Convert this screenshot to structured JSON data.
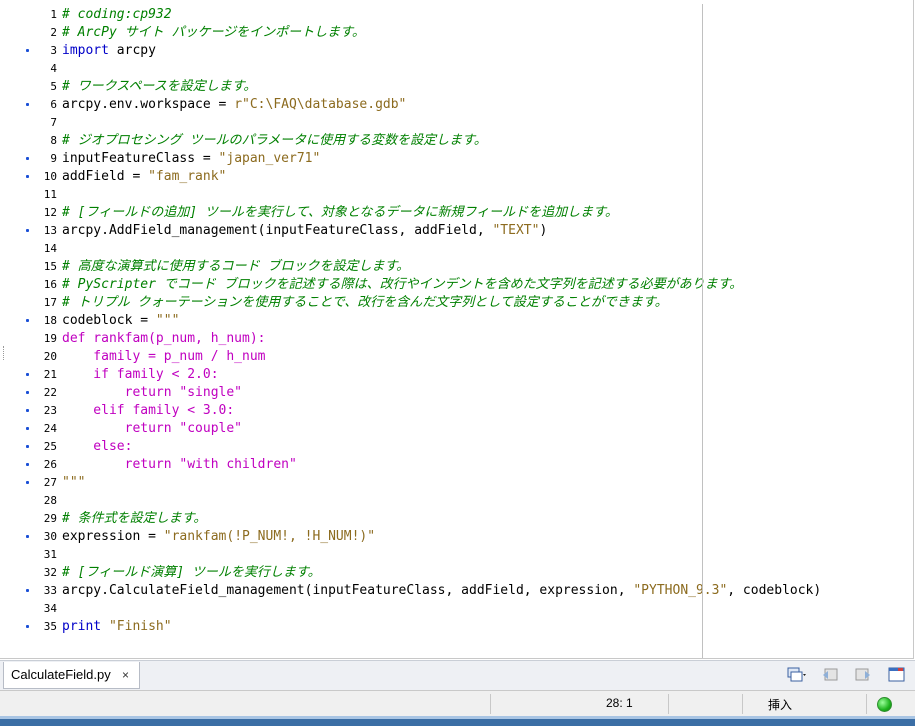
{
  "editor": {
    "lines": [
      {
        "n": "1",
        "bp": false,
        "tokens": [
          {
            "t": "# coding:cp932",
            "c": "comment"
          }
        ]
      },
      {
        "n": "2",
        "bp": false,
        "tokens": [
          {
            "t": "# ArcPy サイト パッケージをインポートします。",
            "c": "comment"
          }
        ]
      },
      {
        "n": "3",
        "bp": true,
        "tokens": [
          {
            "t": "import",
            "c": "keyword"
          },
          {
            "t": " arcpy",
            "c": "plain"
          }
        ]
      },
      {
        "n": "4",
        "bp": false,
        "tokens": []
      },
      {
        "n": "5",
        "bp": false,
        "tokens": [
          {
            "t": "# ワークスペースを設定します。",
            "c": "comment"
          }
        ]
      },
      {
        "n": "6",
        "bp": true,
        "tokens": [
          {
            "t": "arcpy.env.workspace = ",
            "c": "plain"
          },
          {
            "t": "r\"C:\\FAQ\\database.gdb\"",
            "c": "string"
          }
        ]
      },
      {
        "n": "7",
        "bp": false,
        "tokens": []
      },
      {
        "n": "8",
        "bp": false,
        "tokens": [
          {
            "t": "# ジオプロセシング ツールのパラメータに使用する変数を設定します。",
            "c": "comment"
          }
        ]
      },
      {
        "n": "9",
        "bp": true,
        "tokens": [
          {
            "t": "inputFeatureClass = ",
            "c": "plain"
          },
          {
            "t": "\"japan_ver71\"",
            "c": "string"
          }
        ]
      },
      {
        "n": "10",
        "bp": true,
        "tokens": [
          {
            "t": "addField = ",
            "c": "plain"
          },
          {
            "t": "\"fam_rank\"",
            "c": "string"
          }
        ]
      },
      {
        "n": "11",
        "bp": false,
        "tokens": []
      },
      {
        "n": "12",
        "bp": false,
        "tokens": [
          {
            "t": "# [フィールドの追加] ツールを実行して、対象となるデータに新規フィールドを追加します。",
            "c": "comment"
          }
        ]
      },
      {
        "n": "13",
        "bp": true,
        "tokens": [
          {
            "t": "arcpy.AddField_management(inputFeatureClass, addField, ",
            "c": "plain"
          },
          {
            "t": "\"TEXT\"",
            "c": "string"
          },
          {
            "t": ")",
            "c": "plain"
          }
        ]
      },
      {
        "n": "14",
        "bp": false,
        "tokens": []
      },
      {
        "n": "15",
        "bp": false,
        "tokens": [
          {
            "t": "# 高度な演算式に使用するコード ブロックを設定します。",
            "c": "comment"
          }
        ]
      },
      {
        "n": "16",
        "bp": false,
        "tokens": [
          {
            "t": "# PyScripter でコード ブロックを記述する際は、改行やインデントを含めた文字列を記述する必要があります。",
            "c": "comment"
          }
        ]
      },
      {
        "n": "17",
        "bp": false,
        "tokens": [
          {
            "t": "# トリプル クォーテーションを使用することで、改行を含んだ文字列として設定することができます。",
            "c": "comment"
          }
        ]
      },
      {
        "n": "18",
        "bp": true,
        "tokens": [
          {
            "t": "codeblock = ",
            "c": "plain"
          },
          {
            "t": "\"\"\"",
            "c": "string"
          }
        ]
      },
      {
        "n": "19",
        "bp": false,
        "tokens": [
          {
            "t": "def rankfam(p_num, h_num):",
            "c": "def"
          }
        ]
      },
      {
        "n": "20",
        "bp": false,
        "tokens": [
          {
            "t": "    family = p_num / h_num",
            "c": "def"
          }
        ]
      },
      {
        "n": "21",
        "bp": true,
        "tokens": [
          {
            "t": "    if family < 2.0:",
            "c": "def"
          }
        ]
      },
      {
        "n": "22",
        "bp": true,
        "tokens": [
          {
            "t": "        return \"single\"",
            "c": "def"
          }
        ]
      },
      {
        "n": "23",
        "bp": true,
        "tokens": [
          {
            "t": "    elif family < 3.0:",
            "c": "def"
          }
        ]
      },
      {
        "n": "24",
        "bp": true,
        "tokens": [
          {
            "t": "        return \"couple\"",
            "c": "def"
          }
        ]
      },
      {
        "n": "25",
        "bp": true,
        "tokens": [
          {
            "t": "    else:",
            "c": "def"
          }
        ]
      },
      {
        "n": "26",
        "bp": true,
        "tokens": [
          {
            "t": "        return \"with children\"",
            "c": "def"
          }
        ]
      },
      {
        "n": "27",
        "bp": true,
        "tokens": [
          {
            "t": "\"\"\"",
            "c": "string"
          }
        ]
      },
      {
        "n": "28",
        "bp": false,
        "tokens": []
      },
      {
        "n": "29",
        "bp": false,
        "tokens": [
          {
            "t": "# 条件式を設定します。",
            "c": "comment"
          }
        ]
      },
      {
        "n": "30",
        "bp": true,
        "tokens": [
          {
            "t": "expression = ",
            "c": "plain"
          },
          {
            "t": "\"rankfam(!P_NUM!, !H_NUM!)\"",
            "c": "string"
          }
        ]
      },
      {
        "n": "31",
        "bp": false,
        "tokens": []
      },
      {
        "n": "32",
        "bp": false,
        "tokens": [
          {
            "t": "# [フィールド演算] ツールを実行します。",
            "c": "comment"
          }
        ]
      },
      {
        "n": "33",
        "bp": true,
        "tokens": [
          {
            "t": "arcpy.CalculateField_management(inputFeatureClass, addField, expression, ",
            "c": "plain"
          },
          {
            "t": "\"PYTHON_9.3\"",
            "c": "string"
          },
          {
            "t": ", codeblock)",
            "c": "plain"
          }
        ]
      },
      {
        "n": "34",
        "bp": false,
        "tokens": []
      },
      {
        "n": "35",
        "bp": true,
        "tokens": [
          {
            "t": "print",
            "c": "keyword"
          },
          {
            "t": " ",
            "c": "plain"
          },
          {
            "t": "\"Finish\"",
            "c": "string"
          }
        ]
      }
    ]
  },
  "tabbar": {
    "active_tab": "CalculateField.py",
    "close_glyph": "×",
    "tools": [
      "window-layout-icon",
      "nav-back-icon",
      "nav-forward-icon",
      "window-icon"
    ]
  },
  "statusbar": {
    "cursor_pos": "28:  1",
    "mode": "挿入"
  },
  "colors": {
    "comment": "#008000",
    "keyword": "#0000c8",
    "string": "#8c6b1f",
    "def": "#c000c0"
  }
}
